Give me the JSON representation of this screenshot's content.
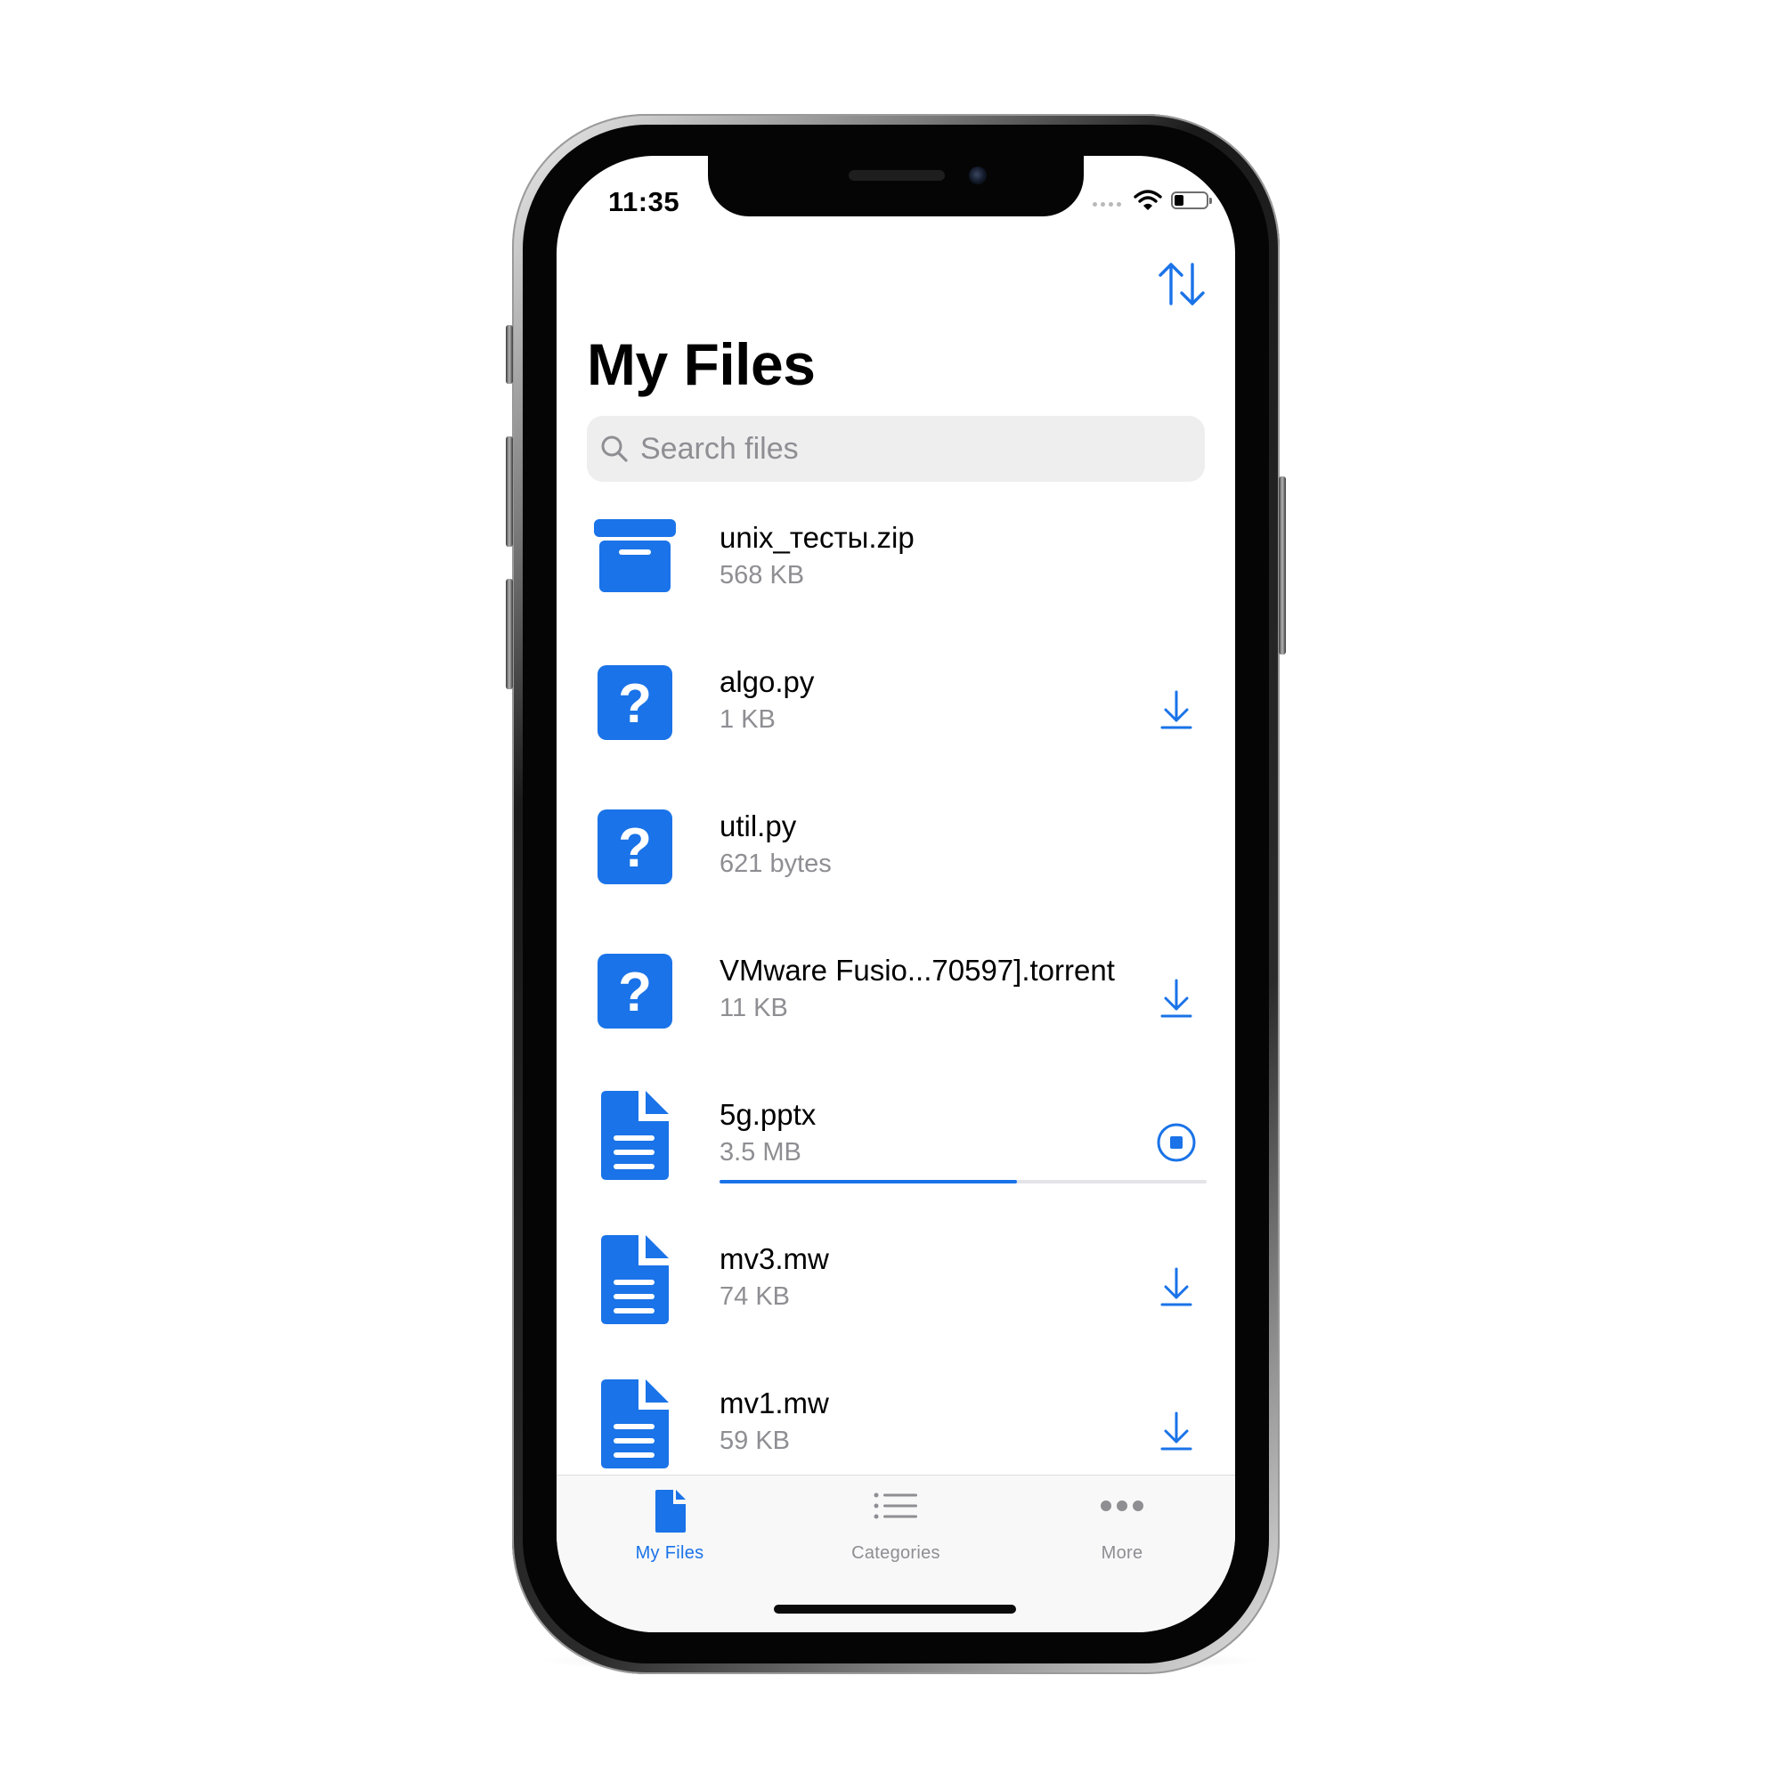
{
  "colors": {
    "accent": "#1a73e8",
    "secondary_text": "#8e8e93",
    "tab_inactive": "#8e8e93"
  },
  "status_bar": {
    "time": "11:35"
  },
  "nav": {
    "sort_icon": "sort-arrows-icon"
  },
  "header": {
    "title": "My Files"
  },
  "search": {
    "placeholder": "Search files",
    "value": ""
  },
  "files": [
    {
      "name": "unix_тесты.zip",
      "size": "568 KB",
      "type": "archive",
      "action": "none"
    },
    {
      "name": "algo.py",
      "size": "1 KB",
      "type": "unknown",
      "action": "download"
    },
    {
      "name": "util.py",
      "size": "621 bytes",
      "type": "unknown",
      "action": "none"
    },
    {
      "name": "VMware Fusio...70597].torrent",
      "size": "11 KB",
      "type": "unknown",
      "action": "download"
    },
    {
      "name": "5g.pptx",
      "size": "3.5 MB",
      "type": "document",
      "action": "stop",
      "progress": 0.61
    },
    {
      "name": "mv3.mw",
      "size": "74 KB",
      "type": "document",
      "action": "download"
    },
    {
      "name": "mv1.mw",
      "size": "59 KB",
      "type": "document",
      "action": "download"
    }
  ],
  "tab_bar": {
    "tabs": [
      {
        "label": "My Files",
        "icon": "document-icon",
        "active": true
      },
      {
        "label": "Categories",
        "icon": "list-icon",
        "active": false
      },
      {
        "label": "More",
        "icon": "more-dots-icon",
        "active": false
      }
    ]
  }
}
